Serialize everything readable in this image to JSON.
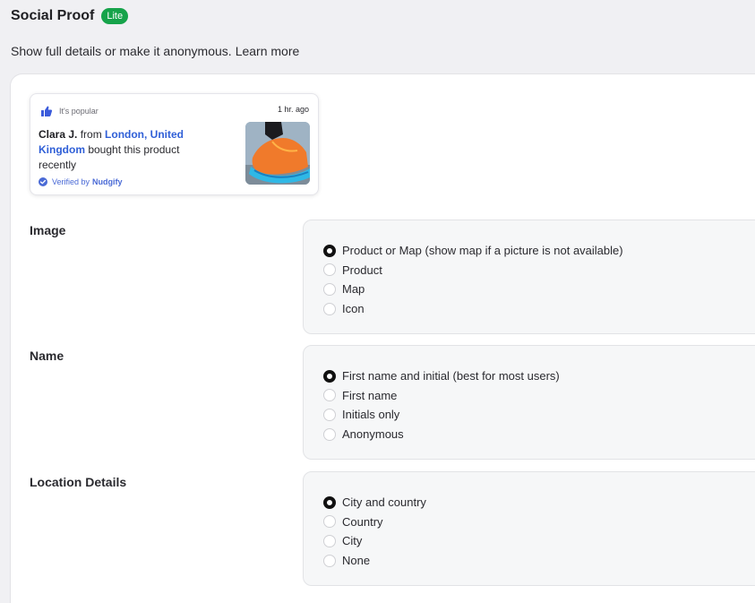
{
  "header": {
    "title": "Social Proof",
    "badge": "Lite",
    "subtitle": "Show full details or make it anonymous.",
    "learn_more": "Learn more"
  },
  "preview": {
    "tag": "It's popular",
    "time": "1 hr. ago",
    "name": "Clara J.",
    "from": " from ",
    "location": "London, United Kingdom",
    "action": " bought this product recently",
    "verified_prefix": "Verified by",
    "brand": "Nudgify",
    "accent_color": "#2f5fd7"
  },
  "sections": {
    "image": {
      "label": "Image",
      "options": [
        {
          "label": "Product or Map (show map if a picture is not available)",
          "selected": true
        },
        {
          "label": "Product",
          "selected": false
        },
        {
          "label": "Map",
          "selected": false
        },
        {
          "label": "Icon",
          "selected": false
        }
      ]
    },
    "name": {
      "label": "Name",
      "options": [
        {
          "label": "First name and initial (best for most users)",
          "selected": true
        },
        {
          "label": "First name",
          "selected": false
        },
        {
          "label": "Initials only",
          "selected": false
        },
        {
          "label": "Anonymous",
          "selected": false
        }
      ]
    },
    "location": {
      "label": "Location Details",
      "options": [
        {
          "label": "City and country",
          "selected": true
        },
        {
          "label": "Country",
          "selected": false
        },
        {
          "label": "City",
          "selected": false
        },
        {
          "label": "None",
          "selected": false
        }
      ]
    }
  }
}
